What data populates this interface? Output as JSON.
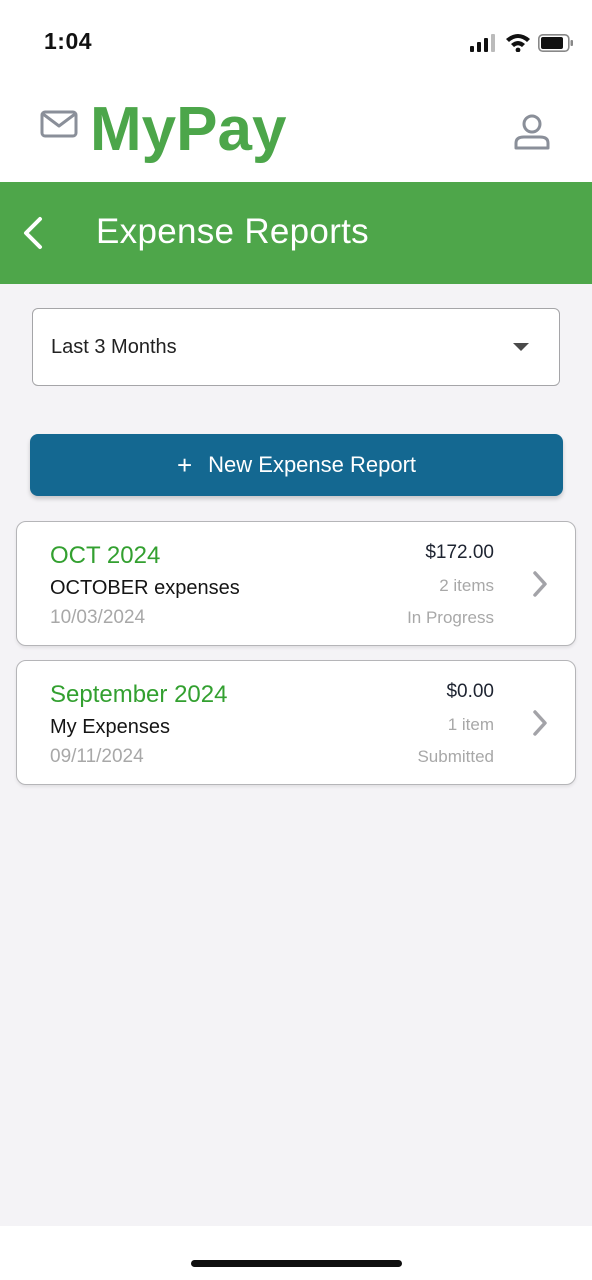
{
  "status_bar": {
    "time": "1:04"
  },
  "app": {
    "brand": "MyPay",
    "brand_color": "#4ca64a"
  },
  "title_bar": {
    "title": "Expense Reports",
    "color": "#4ea64a"
  },
  "filter": {
    "selected": "Last 3 Months"
  },
  "new_report_button": {
    "label": "New Expense Report",
    "color": "#146891"
  },
  "reports": [
    {
      "period": "OCT 2024",
      "name": "OCTOBER expenses",
      "date": "10/03/2024",
      "amount": "$172.00",
      "items": "2 items",
      "status": "In Progress"
    },
    {
      "period": "September 2024",
      "name": "My Expenses",
      "date": "09/11/2024",
      "amount": "$0.00",
      "items": "1 item",
      "status": "Submitted"
    }
  ],
  "icons": {
    "mail": "mail-icon",
    "profile": "profile-icon",
    "back": "back-icon",
    "caret": "caret-down-icon",
    "plus": "plus-icon",
    "chevron": "chevron-right-icon"
  }
}
